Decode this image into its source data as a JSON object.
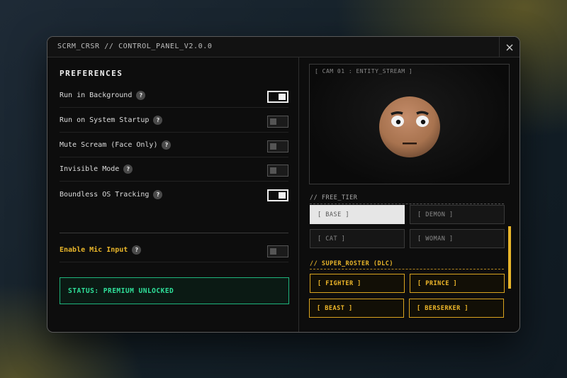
{
  "window": {
    "title": "SCRM_CRSR // CONTROL_PANEL_V2.0.0"
  },
  "preferences": {
    "title": "PREFERENCES",
    "help_glyph": "?",
    "items": [
      {
        "label": "Run in Background",
        "on": true
      },
      {
        "label": "Run on System Startup",
        "on": false
      },
      {
        "label": "Mute Scream (Face Only)",
        "on": false
      },
      {
        "label": "Invisible Mode",
        "on": false
      },
      {
        "label": "Boundless OS Tracking",
        "on": true
      }
    ],
    "mic": {
      "label": "Enable Mic Input",
      "on": false
    }
  },
  "status": {
    "text": "STATUS: PREMIUM UNLOCKED"
  },
  "camera": {
    "label": "[ CAM 01 : ENTITY_STREAM ]"
  },
  "free_tier": {
    "title": "// FREE_TIER",
    "items": [
      {
        "label": "[ BASE ]",
        "selected": true
      },
      {
        "label": "[ DEMON ]",
        "selected": false
      },
      {
        "label": "[ CAT ]",
        "selected": false
      },
      {
        "label": "[ WOMAN ]",
        "selected": false
      }
    ]
  },
  "dlc": {
    "title": "// SUPER_ROSTER (DLC)",
    "items": [
      {
        "label": "[ FIGHTER ]"
      },
      {
        "label": "[ PRINCE ]"
      },
      {
        "label": "[ BEAST ]"
      },
      {
        "label": "[ BERSERKER ]"
      }
    ]
  },
  "colors": {
    "accent_yellow": "#e8b52a",
    "status_green": "#2fe09a",
    "face_skin": "#b07a5a"
  },
  "icons": {
    "close": "close-icon",
    "help": "help-icon"
  }
}
